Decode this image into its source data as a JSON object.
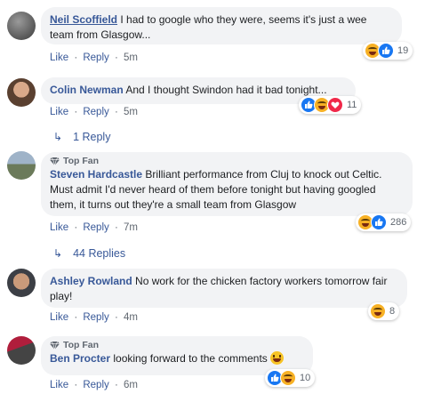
{
  "meta": {
    "like": "Like",
    "reply": "Reply",
    "sep": "·"
  },
  "comments": [
    {
      "name": "Neil Scoffield",
      "text": "I had to google who they were, seems it's just a wee team from Glasgow...",
      "time": "5m",
      "reaction_count": "19",
      "reactions": [
        "haha-icon",
        "like-icon"
      ]
    },
    {
      "name": "Colin Newman",
      "text": "And I thought Swindon had it bad tonight...",
      "time": "5m",
      "reaction_count": "11",
      "reactions": [
        "like-icon",
        "haha-icon",
        "love-icon"
      ],
      "replies": "1 Reply"
    },
    {
      "badge": "Top Fan",
      "name": "Steven Hardcastle",
      "text": "Brilliant performance from Cluj to knock out Celtic. Must admit I'd never heard of them before tonight but having googled them, it turns out they're a small team from Glasgow",
      "time": "7m",
      "reaction_count": "286",
      "reactions": [
        "haha-icon",
        "like-icon"
      ],
      "replies": "44 Replies"
    },
    {
      "name": "Ashley Rowland",
      "text": "No work for the chicken factory workers tomorrow fair play!",
      "time": "4m",
      "reaction_count": "8",
      "reactions": [
        "haha-icon"
      ]
    },
    {
      "badge": "Top Fan",
      "name": "Ben Procter",
      "text": "looking forward to the comments",
      "time": "6m",
      "reaction_count": "10",
      "reactions": [
        "like-icon",
        "haha-icon"
      ]
    }
  ],
  "colors": {
    "link": "#385898",
    "bubble": "#f2f3f5",
    "meta": "#606770",
    "like": "#1877f2",
    "haha": "#f7b125",
    "love": "#f02849"
  }
}
